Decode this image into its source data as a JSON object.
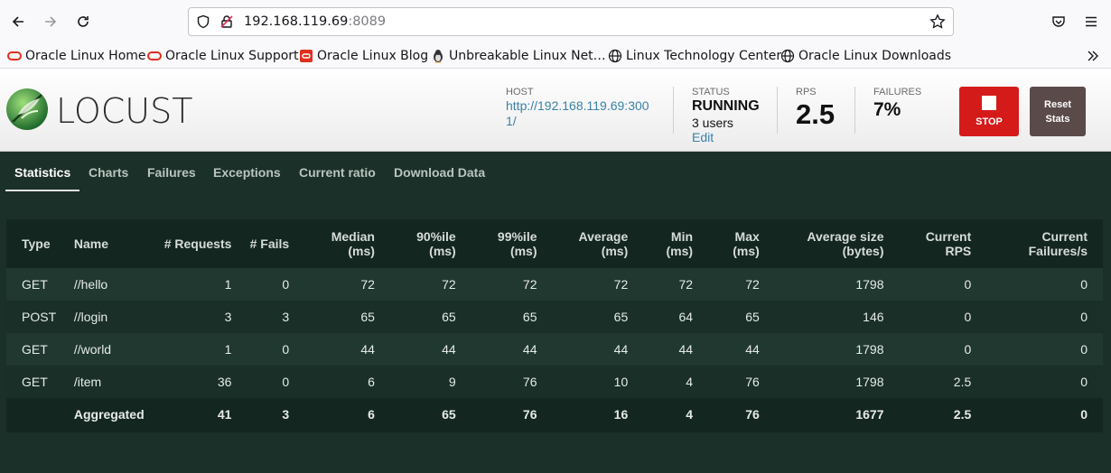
{
  "browser": {
    "url_host": "192.168.119.69",
    "url_port": ":8089",
    "bookmarks": [
      {
        "label": "Oracle Linux Home",
        "icon": "oracle-ring-icon"
      },
      {
        "label": "Oracle Linux Support",
        "icon": "oracle-ring-icon"
      },
      {
        "label": "Oracle Linux Blog",
        "icon": "oracle-square-icon"
      },
      {
        "label": "Unbreakable Linux Net…",
        "icon": "tux-icon"
      },
      {
        "label": "Linux Technology Center",
        "icon": "globe-icon"
      },
      {
        "label": "Oracle Linux Downloads",
        "icon": "globe-icon"
      }
    ]
  },
  "locust": {
    "logo_text": "LOCUST",
    "host_label": "HOST",
    "host_value": "http://192.168.119.69:3001/",
    "status_label": "STATUS",
    "status_value": "RUNNING",
    "users": "3 users",
    "edit": "Edit",
    "rps_label": "RPS",
    "rps_value": "2.5",
    "failures_label": "FAILURES",
    "failures_value": "7%",
    "stop_label": "STOP",
    "reset_label": "Reset Stats",
    "accent": "#d51a1a"
  },
  "tabs": [
    "Statistics",
    "Charts",
    "Failures",
    "Exceptions",
    "Current ratio",
    "Download Data"
  ],
  "table": {
    "headers": [
      "Type",
      "Name",
      "# Requests",
      "# Fails",
      "Median (ms)",
      "90%ile (ms)",
      "99%ile (ms)",
      "Average (ms)",
      "Min (ms)",
      "Max (ms)",
      "Average size (bytes)",
      "Current RPS",
      "Current Failures/s"
    ],
    "rows": [
      [
        "GET",
        "//hello",
        "1",
        "0",
        "72",
        "72",
        "72",
        "72",
        "72",
        "72",
        "1798",
        "0",
        "0"
      ],
      [
        "POST",
        "//login",
        "3",
        "3",
        "65",
        "65",
        "65",
        "65",
        "64",
        "65",
        "146",
        "0",
        "0"
      ],
      [
        "GET",
        "//world",
        "1",
        "0",
        "44",
        "44",
        "44",
        "44",
        "44",
        "44",
        "1798",
        "0",
        "0"
      ],
      [
        "GET",
        "/item",
        "36",
        "0",
        "6",
        "9",
        "76",
        "10",
        "4",
        "76",
        "1798",
        "2.5",
        "0"
      ]
    ],
    "aggregated": [
      "",
      "Aggregated",
      "41",
      "3",
      "6",
      "65",
      "76",
      "16",
      "4",
      "76",
      "1677",
      "2.5",
      "0"
    ]
  }
}
